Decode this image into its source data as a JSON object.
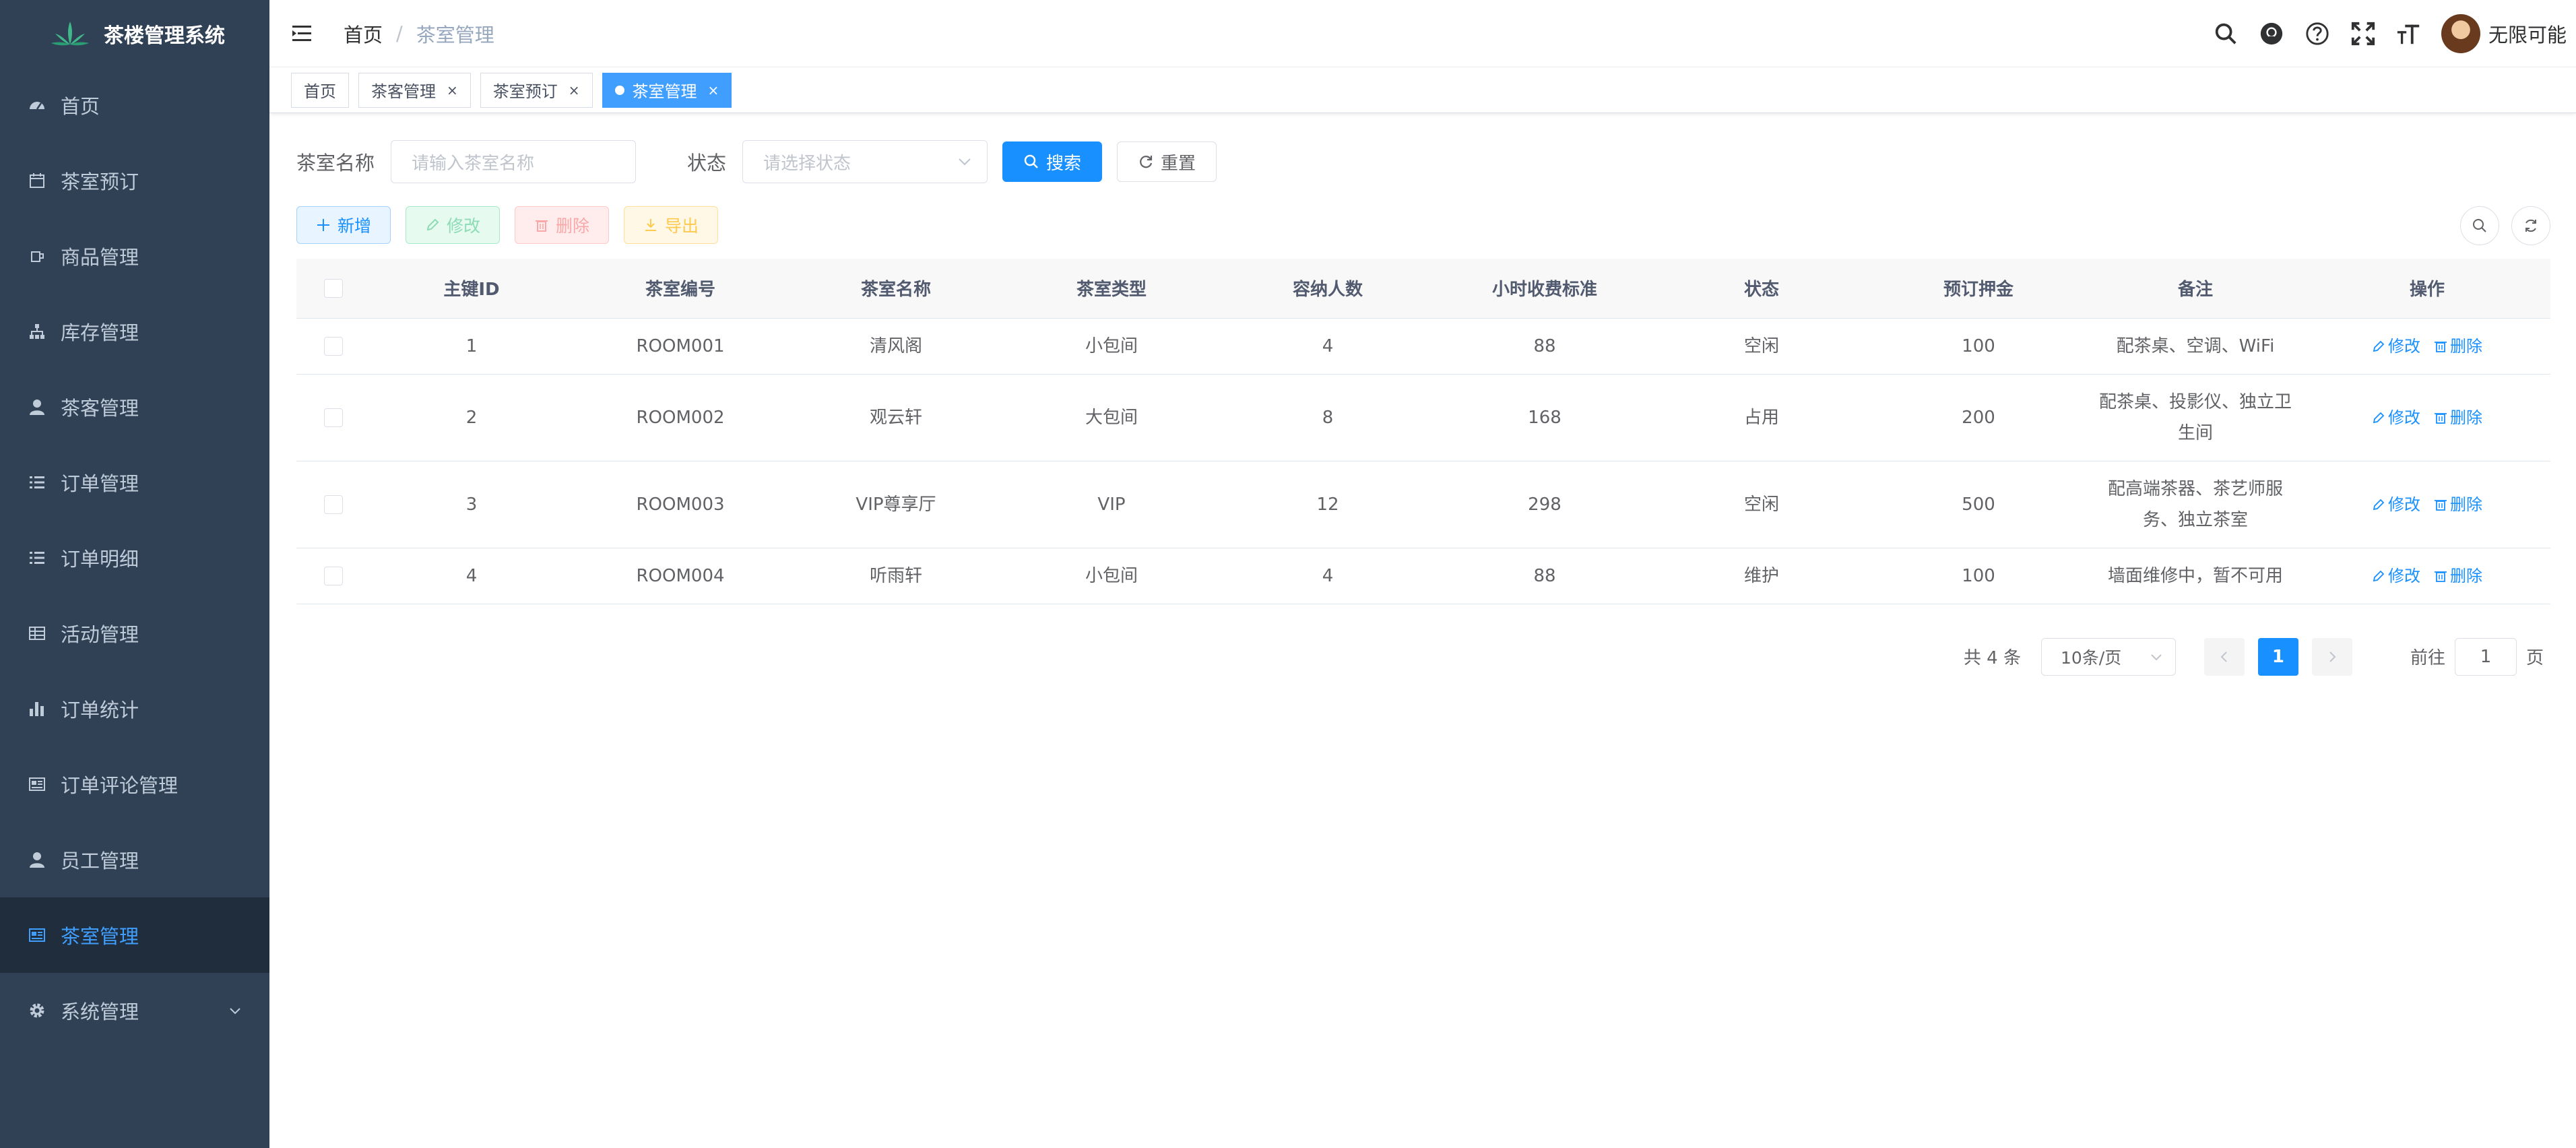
{
  "app": {
    "title": "茶楼管理系统"
  },
  "sidebar": {
    "items": [
      {
        "label": "首页",
        "icon": "dashboard-icon"
      },
      {
        "label": "茶室预订",
        "icon": "calendar-icon"
      },
      {
        "label": "商品管理",
        "icon": "goods-icon"
      },
      {
        "label": "库存管理",
        "icon": "tree-icon"
      },
      {
        "label": "茶客管理",
        "icon": "user-icon"
      },
      {
        "label": "订单管理",
        "icon": "list-icon"
      },
      {
        "label": "订单明细",
        "icon": "list-icon"
      },
      {
        "label": "活动管理",
        "icon": "table-icon"
      },
      {
        "label": "订单统计",
        "icon": "chart-icon"
      },
      {
        "label": "订单评论管理",
        "icon": "form-icon"
      },
      {
        "label": "员工管理",
        "icon": "user-icon"
      },
      {
        "label": "茶室管理",
        "icon": "form-icon",
        "active": true
      },
      {
        "label": "系统管理",
        "icon": "gear-icon"
      }
    ]
  },
  "navbar": {
    "breadcrumb": {
      "home": "首页",
      "separator": "/",
      "current": "茶室管理"
    },
    "username": "无限可能"
  },
  "tags": [
    {
      "label": "首页",
      "closable": false,
      "active": false
    },
    {
      "label": "茶客管理",
      "closable": true,
      "active": false
    },
    {
      "label": "茶室预订",
      "closable": true,
      "active": false
    },
    {
      "label": "茶室管理",
      "closable": true,
      "active": true
    }
  ],
  "tag_close": "×",
  "search": {
    "name_label": "茶室名称",
    "name_placeholder": "请输入茶室名称",
    "status_label": "状态",
    "status_placeholder": "请选择状态",
    "search_button": "搜索",
    "reset_button": "重置"
  },
  "toolbar": {
    "add": "新增",
    "edit": "修改",
    "delete": "删除",
    "export": "导出"
  },
  "table": {
    "columns": [
      "主键ID",
      "茶室编号",
      "茶室名称",
      "茶室类型",
      "容纳人数",
      "小时收费标准",
      "状态",
      "预订押金",
      "备注",
      "操作"
    ],
    "rows": [
      [
        "1",
        "ROOM001",
        "清风阁",
        "小包间",
        "4",
        "88",
        "空闲",
        "100",
        "配茶桌、空调、WiFi"
      ],
      [
        "2",
        "ROOM002",
        "观云轩",
        "大包间",
        "8",
        "168",
        "占用",
        "200",
        "配茶桌、投影仪、独立卫生间"
      ],
      [
        "3",
        "ROOM003",
        "VIP尊享厅",
        "VIP",
        "12",
        "298",
        "空闲",
        "500",
        "配高端茶器、茶艺师服务、独立茶室"
      ],
      [
        "4",
        "ROOM004",
        "听雨轩",
        "小包间",
        "4",
        "88",
        "维护",
        "100",
        "墙面维修中，暂不可用"
      ]
    ],
    "row_edit": "修改",
    "row_delete": "删除"
  },
  "pagination": {
    "total": "共 4 条",
    "page_size": "10条/页",
    "current_page": "1",
    "goto_label": "前往",
    "goto_value": "1",
    "goto_unit": "页"
  },
  "colors": {
    "primary": "#1890ff",
    "sidebar_bg": "#304156",
    "sidebar_active_bg": "#1f2d3d",
    "active_text": "#409eff"
  }
}
